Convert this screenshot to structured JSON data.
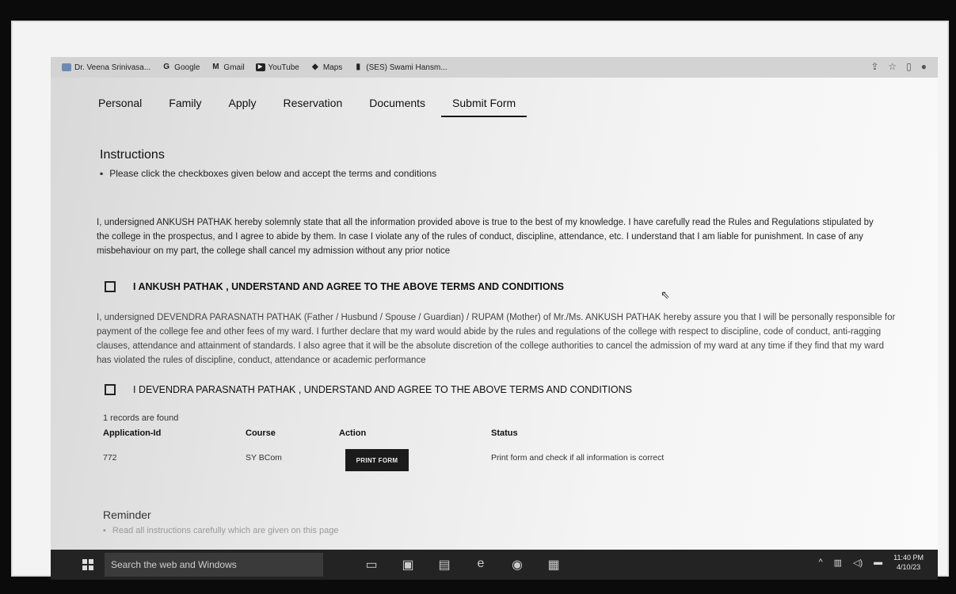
{
  "bookmarks": [
    {
      "icon": "profile-icon",
      "label": "Dr. Veena Srinivasa..."
    },
    {
      "icon": "google-icon",
      "glyph": "G",
      "label": "Google"
    },
    {
      "icon": "gmail-icon",
      "glyph": "M",
      "label": "Gmail"
    },
    {
      "icon": "youtube-icon",
      "glyph": "▶",
      "label": "YouTube"
    },
    {
      "icon": "maps-icon",
      "glyph": "◆",
      "label": "Maps"
    },
    {
      "icon": "book-icon",
      "glyph": "▮",
      "label": "(SES) Swami Hansm..."
    }
  ],
  "tabs": [
    "Personal",
    "Family",
    "Apply",
    "Reservation",
    "Documents",
    "Submit Form"
  ],
  "active_tab": "Submit Form",
  "instructions": {
    "title": "Instructions",
    "bullet": "Please click the checkboxes given below and accept the terms and conditions"
  },
  "declaration_student": "I, undersigned ANKUSH PATHAK hereby solemnly state that all the information provided above is true to the best of my knowledge. I have carefully read the Rules and Regulations stipulated by the college in the prospectus, and I agree to abide by them. In case I violate any of the rules of conduct, discipline, attendance, etc. I understand that I am liable for punishment. In case of any misbehaviour on my part, the college shall cancel my admission without any prior notice",
  "checkbox_student": "I ANKUSH PATHAK , UNDERSTAND AND AGREE TO THE ABOVE TERMS AND CONDITIONS",
  "declaration_parent": "I, undersigned DEVENDRA PARASNATH PATHAK (Father / Husbund / Spouse / Guardian) / RUPAM (Mother) of Mr./Ms. ANKUSH PATHAK hereby assure you that I will be personally responsible for payment of the college fee and other fees of my ward. I further declare that my ward would abide by the rules and regulations of the college with respect to discipline, code of conduct, anti-ragging clauses, attendance and attainment of standards. I also agree that it will be the absolute discretion of the college authorities to cancel the admission of my ward at any time if they find that my ward has violated the rules of discipline, conduct, attendance or academic performance",
  "checkbox_parent": "I DEVENDRA PARASNATH PATHAK , UNDERSTAND AND AGREE TO THE ABOVE TERMS AND CONDITIONS",
  "records_found": "1 records are found",
  "table": {
    "headers": [
      "Application-Id",
      "Course",
      "Action",
      "Status"
    ],
    "row": {
      "application_id": "772",
      "course": "SY BCom",
      "action_label": "PRINT FORM",
      "status": "Print form and check if all information is correct"
    }
  },
  "reminder": {
    "title": "Reminder",
    "bullet": "Read all instructions carefully which are given on this page"
  },
  "taskbar": {
    "search_placeholder": "Search the web and Windows",
    "time": "11:40 PM",
    "date": "4/10/23"
  }
}
